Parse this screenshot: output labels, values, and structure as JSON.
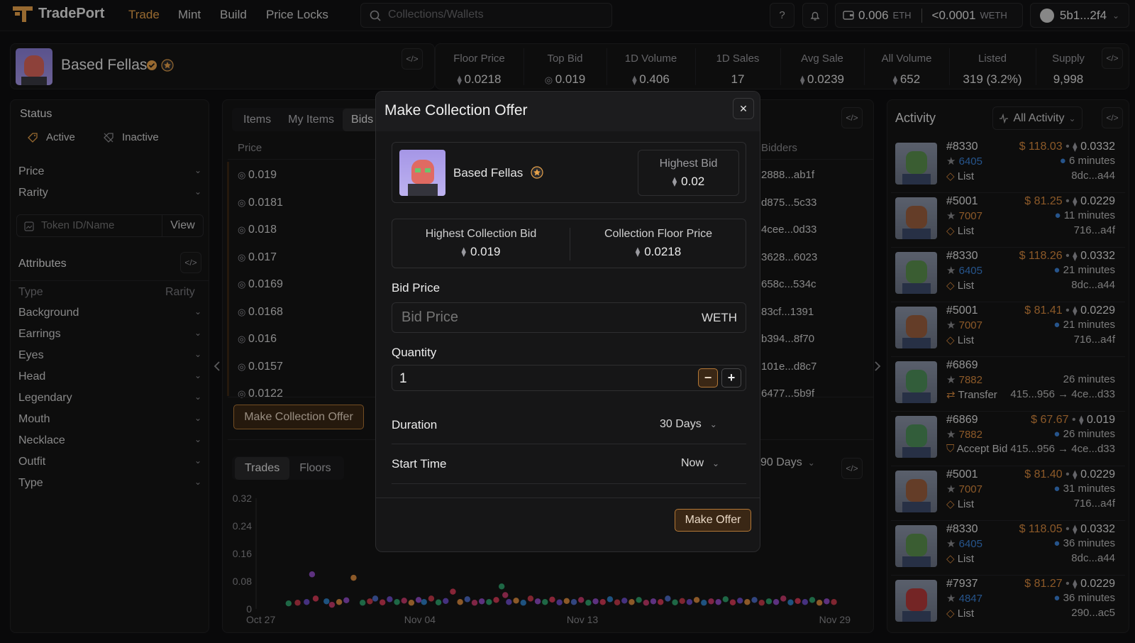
{
  "topnav": {
    "brand": "TradePort",
    "links": [
      "Trade",
      "Mint",
      "Build",
      "Price Locks"
    ],
    "search_placeholder": "Collections/Wallets",
    "help": "?",
    "wallet_eth": "0.006",
    "wallet_eth_unit": "ETH",
    "wallet_weth": "<0.0001",
    "wallet_weth_unit": "WETH",
    "account": "5b1...2f4"
  },
  "collection": {
    "name": "Based Fellas",
    "stats": [
      {
        "label": "Floor Price",
        "value": "0.0218",
        "icon": "eth-icon"
      },
      {
        "label": "Top Bid",
        "value": "0.019",
        "icon": "weth-icon"
      },
      {
        "label": "1D Volume",
        "value": "0.406",
        "icon": "eth-icon"
      },
      {
        "label": "1D Sales",
        "value": "17",
        "icon": ""
      },
      {
        "label": "Avg Sale",
        "value": "0.0239",
        "icon": "eth-icon"
      },
      {
        "label": "All Volume",
        "value": "652",
        "icon": "eth-icon"
      },
      {
        "label": "Listed",
        "value": "319 (3.2%)",
        "icon": ""
      },
      {
        "label": "Supply",
        "value": "9,998",
        "icon": ""
      }
    ]
  },
  "filters": {
    "status_title": "Status",
    "active": "Active",
    "inactive": "Inactive",
    "price": "Price",
    "rarity": "Rarity",
    "token_placeholder": "Token ID/Name",
    "view": "View",
    "attributes_title": "Attributes",
    "type_header": "Type",
    "rarity_header": "Rarity",
    "attributes": [
      "Background",
      "Earrings",
      "Eyes",
      "Head",
      "Legendary",
      "Mouth",
      "Necklace",
      "Outfit",
      "Type"
    ]
  },
  "center": {
    "tabs": [
      "Items",
      "My Items",
      "Bids"
    ],
    "price_header": "Price",
    "bidders_header": "Bidders",
    "bids": [
      {
        "price": "0.019",
        "bidder": "2888...ab1f"
      },
      {
        "price": "0.0181",
        "bidder": "d875...5c33"
      },
      {
        "price": "0.018",
        "bidder": "4cee...0d33"
      },
      {
        "price": "0.017",
        "bidder": "3628...6023"
      },
      {
        "price": "0.0169",
        "bidder": "658c...534c"
      },
      {
        "price": "0.0168",
        "bidder": "83cf...1391"
      },
      {
        "price": "0.016",
        "bidder": "b394...8f70"
      },
      {
        "price": "0.0157",
        "bidder": "101e...d8c7"
      },
      {
        "price": "0.0122",
        "bidder": "6477...5b9f"
      }
    ],
    "make_offer_button": "Make Collection Offer",
    "chart_tabs": [
      "Trades",
      "Floors"
    ],
    "range": "90 Days"
  },
  "chart_data": {
    "type": "scatter",
    "x_ticks": [
      "Oct 27",
      "Nov 04",
      "Nov 13",
      "Nov 29"
    ],
    "y_ticks": [
      "0.32",
      "0.24",
      "0.16",
      "0.08",
      "0"
    ],
    "ylim": [
      0,
      0.32
    ],
    "xlim": [
      0,
      33
    ],
    "points": [
      {
        "x": 1.8,
        "y": 0.016,
        "c": "#2f9e6b"
      },
      {
        "x": 2.3,
        "y": 0.018,
        "c": "#c43a4a"
      },
      {
        "x": 2.8,
        "y": 0.02,
        "c": "#6b4cc4"
      },
      {
        "x": 3.1,
        "y": 0.1,
        "c": "#8f4cc4"
      },
      {
        "x": 3.3,
        "y": 0.03,
        "c": "#d23a55"
      },
      {
        "x": 3.9,
        "y": 0.022,
        "c": "#2f7ec4"
      },
      {
        "x": 4.2,
        "y": 0.012,
        "c": "#c43a6b"
      },
      {
        "x": 4.6,
        "y": 0.02,
        "c": "#d7893e"
      },
      {
        "x": 5.0,
        "y": 0.025,
        "c": "#8f4cc4"
      },
      {
        "x": 5.4,
        "y": 0.09,
        "c": "#d7893e"
      },
      {
        "x": 5.9,
        "y": 0.018,
        "c": "#2f9e6b"
      },
      {
        "x": 6.3,
        "y": 0.022,
        "c": "#c43a4a"
      },
      {
        "x": 6.6,
        "y": 0.03,
        "c": "#4c6bc4"
      },
      {
        "x": 7.0,
        "y": 0.019,
        "c": "#d23a55"
      },
      {
        "x": 7.4,
        "y": 0.028,
        "c": "#6b4cc4"
      },
      {
        "x": 7.8,
        "y": 0.02,
        "c": "#2f9e6b"
      },
      {
        "x": 8.2,
        "y": 0.024,
        "c": "#c43a6b"
      },
      {
        "x": 8.6,
        "y": 0.018,
        "c": "#d7893e"
      },
      {
        "x": 9.0,
        "y": 0.026,
        "c": "#8f4cc4"
      },
      {
        "x": 9.3,
        "y": 0.02,
        "c": "#2f7ec4"
      },
      {
        "x": 9.7,
        "y": 0.03,
        "c": "#c43a4a"
      },
      {
        "x": 10.1,
        "y": 0.019,
        "c": "#2f9e6b"
      },
      {
        "x": 10.5,
        "y": 0.023,
        "c": "#6b4cc4"
      },
      {
        "x": 10.9,
        "y": 0.05,
        "c": "#d23a55"
      },
      {
        "x": 11.3,
        "y": 0.02,
        "c": "#d7893e"
      },
      {
        "x": 11.7,
        "y": 0.028,
        "c": "#4c6bc4"
      },
      {
        "x": 12.1,
        "y": 0.018,
        "c": "#c43a6b"
      },
      {
        "x": 12.5,
        "y": 0.022,
        "c": "#8f4cc4"
      },
      {
        "x": 12.9,
        "y": 0.02,
        "c": "#2f9e6b"
      },
      {
        "x": 13.3,
        "y": 0.026,
        "c": "#d23a55"
      },
      {
        "x": 13.6,
        "y": 0.065,
        "c": "#2f9e6b"
      },
      {
        "x": 13.8,
        "y": 0.04,
        "c": "#c43a6b"
      },
      {
        "x": 14.0,
        "y": 0.02,
        "c": "#6b4cc4"
      },
      {
        "x": 14.4,
        "y": 0.024,
        "c": "#d7893e"
      },
      {
        "x": 14.8,
        "y": 0.018,
        "c": "#2f7ec4"
      },
      {
        "x": 15.2,
        "y": 0.03,
        "c": "#c43a4a"
      },
      {
        "x": 15.6,
        "y": 0.022,
        "c": "#8f4cc4"
      },
      {
        "x": 16.0,
        "y": 0.02,
        "c": "#2f9e6b"
      },
      {
        "x": 16.4,
        "y": 0.027,
        "c": "#d23a55"
      },
      {
        "x": 16.8,
        "y": 0.019,
        "c": "#6b4cc4"
      },
      {
        "x": 17.2,
        "y": 0.023,
        "c": "#d7893e"
      },
      {
        "x": 17.6,
        "y": 0.02,
        "c": "#4c6bc4"
      },
      {
        "x": 18.0,
        "y": 0.026,
        "c": "#c43a6b"
      },
      {
        "x": 18.4,
        "y": 0.018,
        "c": "#2f9e6b"
      },
      {
        "x": 18.8,
        "y": 0.022,
        "c": "#8f4cc4"
      },
      {
        "x": 19.2,
        "y": 0.02,
        "c": "#d23a55"
      },
      {
        "x": 19.6,
        "y": 0.028,
        "c": "#2f7ec4"
      },
      {
        "x": 20.0,
        "y": 0.019,
        "c": "#c43a4a"
      },
      {
        "x": 20.4,
        "y": 0.024,
        "c": "#6b4cc4"
      },
      {
        "x": 20.8,
        "y": 0.02,
        "c": "#d7893e"
      },
      {
        "x": 21.2,
        "y": 0.026,
        "c": "#2f9e6b"
      },
      {
        "x": 21.6,
        "y": 0.018,
        "c": "#c43a6b"
      },
      {
        "x": 22.0,
        "y": 0.022,
        "c": "#8f4cc4"
      },
      {
        "x": 22.4,
        "y": 0.02,
        "c": "#d23a55"
      },
      {
        "x": 22.8,
        "y": 0.03,
        "c": "#4c6bc4"
      },
      {
        "x": 23.2,
        "y": 0.019,
        "c": "#2f9e6b"
      },
      {
        "x": 23.6,
        "y": 0.023,
        "c": "#c43a4a"
      },
      {
        "x": 24.0,
        "y": 0.02,
        "c": "#6b4cc4"
      },
      {
        "x": 24.4,
        "y": 0.026,
        "c": "#d7893e"
      },
      {
        "x": 24.8,
        "y": 0.018,
        "c": "#2f7ec4"
      },
      {
        "x": 25.2,
        "y": 0.022,
        "c": "#c43a6b"
      },
      {
        "x": 25.6,
        "y": 0.02,
        "c": "#8f4cc4"
      },
      {
        "x": 26.0,
        "y": 0.028,
        "c": "#2f9e6b"
      },
      {
        "x": 26.4,
        "y": 0.019,
        "c": "#d23a55"
      },
      {
        "x": 26.8,
        "y": 0.024,
        "c": "#6b4cc4"
      },
      {
        "x": 27.2,
        "y": 0.02,
        "c": "#d7893e"
      },
      {
        "x": 27.6,
        "y": 0.026,
        "c": "#4c6bc4"
      },
      {
        "x": 28.0,
        "y": 0.018,
        "c": "#c43a4a"
      },
      {
        "x": 28.4,
        "y": 0.022,
        "c": "#2f9e6b"
      },
      {
        "x": 28.8,
        "y": 0.02,
        "c": "#8f4cc4"
      },
      {
        "x": 29.2,
        "y": 0.03,
        "c": "#c43a6b"
      },
      {
        "x": 29.6,
        "y": 0.019,
        "c": "#2f7ec4"
      },
      {
        "x": 30.0,
        "y": 0.023,
        "c": "#d23a55"
      },
      {
        "x": 30.4,
        "y": 0.02,
        "c": "#6b4cc4"
      },
      {
        "x": 30.8,
        "y": 0.026,
        "c": "#2f9e6b"
      },
      {
        "x": 31.2,
        "y": 0.018,
        "c": "#d7893e"
      },
      {
        "x": 31.6,
        "y": 0.022,
        "c": "#8f4cc4"
      },
      {
        "x": 32.0,
        "y": 0.02,
        "c": "#c43a4a"
      }
    ]
  },
  "activity": {
    "title": "Activity",
    "filter": "All Activity",
    "items": [
      {
        "id": "#8330",
        "rank": "6405",
        "kind": "List",
        "usd": "$ 118.03",
        "eth": "0.0332",
        "time": "6 minutes",
        "addr": "8dc...a44",
        "color": "#5a8f4e"
      },
      {
        "id": "#5001",
        "rank": "7007",
        "kind": "List",
        "usd": "$ 81.25",
        "eth": "0.0229",
        "time": "11 minutes",
        "addr": "716...a4f",
        "color": "#9a5f3e"
      },
      {
        "id": "#8330",
        "rank": "6405",
        "kind": "List",
        "usd": "$ 118.26",
        "eth": "0.0332",
        "time": "21 minutes",
        "addr": "8dc...a44",
        "color": "#5a8f4e"
      },
      {
        "id": "#5001",
        "rank": "7007",
        "kind": "List",
        "usd": "$ 81.41",
        "eth": "0.0229",
        "time": "21 minutes",
        "addr": "716...a4f",
        "color": "#9a5f3e"
      },
      {
        "id": "#6869",
        "rank": "7882",
        "kind": "Transfer",
        "usd": "",
        "eth": "",
        "time": "26 minutes",
        "addr": "415...956 → 4ce...d33",
        "color": "#4e8f5a"
      },
      {
        "id": "#6869",
        "rank": "7882",
        "kind": "Accept Bid",
        "usd": "$ 67.67",
        "eth": "0.019",
        "time": "26 minutes",
        "addr": "415...956 → 4ce...d33",
        "color": "#4e8f5a"
      },
      {
        "id": "#5001",
        "rank": "7007",
        "kind": "List",
        "usd": "$ 81.40",
        "eth": "0.0229",
        "time": "31 minutes",
        "addr": "716...a4f",
        "color": "#9a5f3e"
      },
      {
        "id": "#8330",
        "rank": "6405",
        "kind": "List",
        "usd": "$ 118.05",
        "eth": "0.0332",
        "time": "36 minutes",
        "addr": "8dc...a44",
        "color": "#5a8f4e"
      },
      {
        "id": "#7937",
        "rank": "4847",
        "kind": "List",
        "usd": "$ 81.27",
        "eth": "0.0229",
        "time": "36 minutes",
        "addr": "290...ac5",
        "color": "#b33a3a"
      }
    ]
  },
  "modal": {
    "title": "Make Collection Offer",
    "collection_name": "Based Fellas",
    "highest_bid_label": "Highest Bid",
    "highest_bid_value": "0.02",
    "highest_collection_bid_label": "Highest Collection Bid",
    "highest_collection_bid_value": "0.019",
    "floor_price_label": "Collection Floor Price",
    "floor_price_value": "0.0218",
    "bid_price_label": "Bid Price",
    "bid_price_placeholder": "Bid Price",
    "bid_unit": "WETH",
    "quantity_label": "Quantity",
    "quantity_value": "1",
    "minus": "−",
    "plus": "+",
    "duration_label": "Duration",
    "duration_value": "30 Days",
    "start_label": "Start Time",
    "start_value": "Now",
    "submit": "Make Offer",
    "close": "✕"
  },
  "colors": {
    "accent": "#e8a24a",
    "link": "#3b82d6",
    "rank": "#d7893e"
  }
}
